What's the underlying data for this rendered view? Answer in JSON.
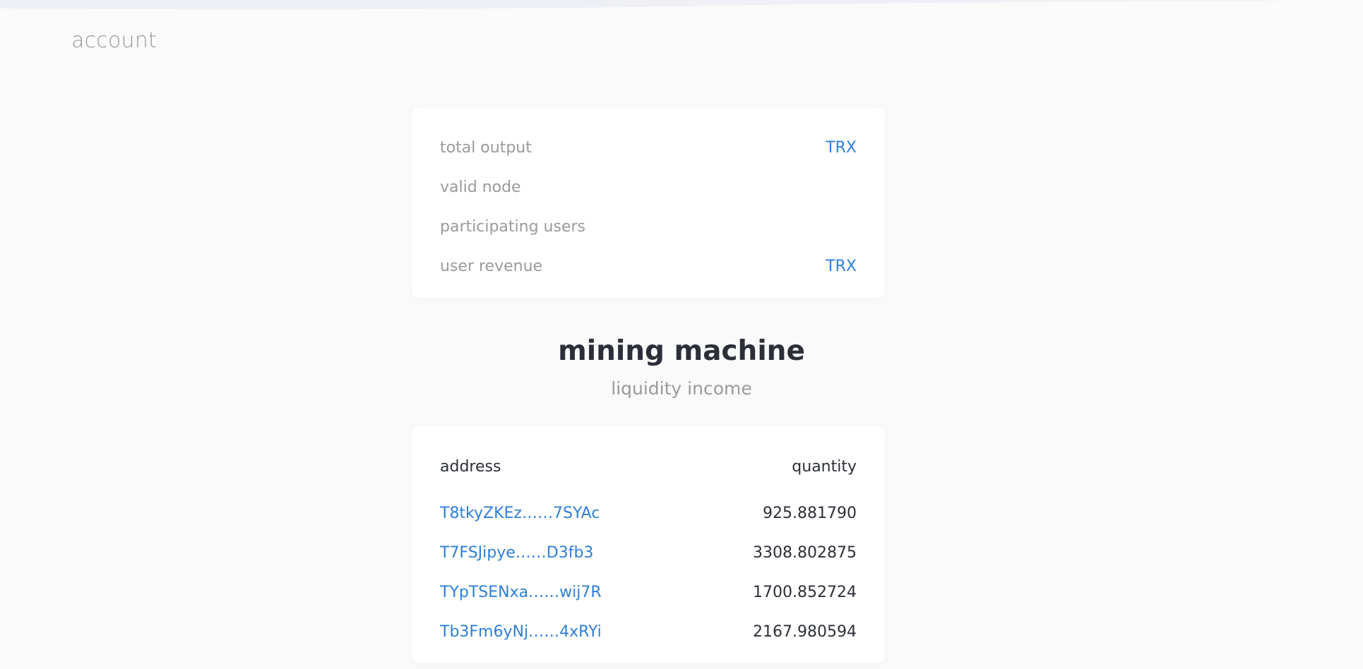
{
  "colors": {
    "background": "#fafafa",
    "card": "#ffffff",
    "accent": "#2f7fd8",
    "muted": "#9a9a9a",
    "text": "#2c2f38"
  },
  "header": {
    "title": "account"
  },
  "stats": {
    "rows": [
      {
        "label": "total output",
        "unit": "TRX"
      },
      {
        "label": "valid node",
        "unit": ""
      },
      {
        "label": "participating users",
        "unit": ""
      },
      {
        "label": "user revenue",
        "unit": "TRX"
      }
    ]
  },
  "mining": {
    "title": "mining machine",
    "subtitle": "liquidity income"
  },
  "income_table": {
    "columns": [
      "address",
      "quantity"
    ],
    "rows": [
      {
        "address": "T8tkyZKEz……7SYAc",
        "quantity": "925.881790"
      },
      {
        "address": "T7FSJipye……D3fb3",
        "quantity": "3308.802875"
      },
      {
        "address": "TYpTSENxa……wij7R",
        "quantity": "1700.852724"
      },
      {
        "address": "Tb3Fm6yNj……4xRYi",
        "quantity": "2167.980594"
      }
    ]
  }
}
